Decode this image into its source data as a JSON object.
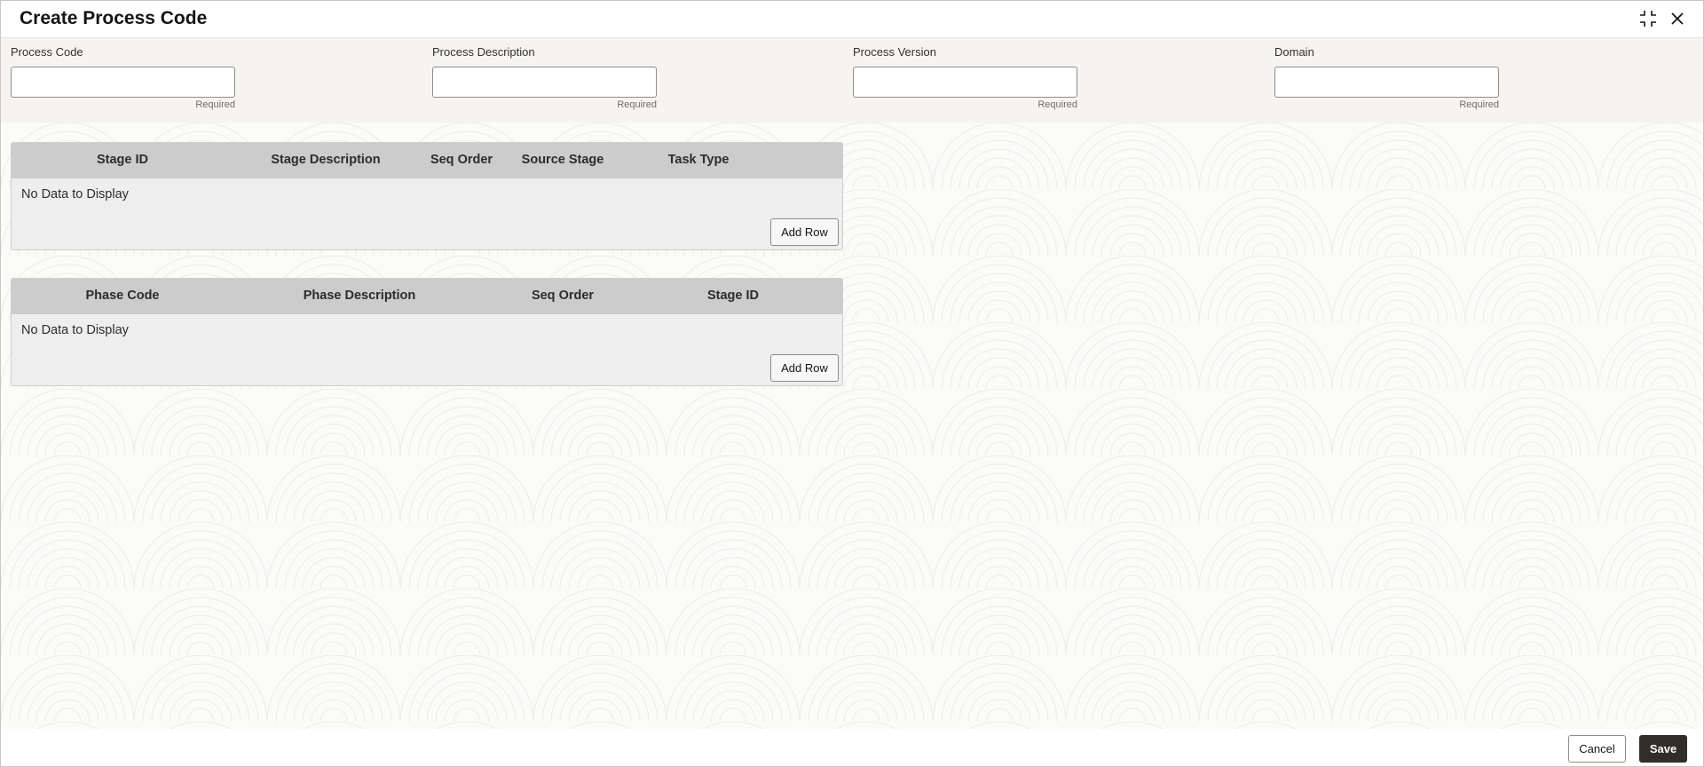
{
  "dialog": {
    "title": "Create Process Code"
  },
  "window_controls": {
    "minimize_icon": "compress-icon",
    "close_icon": "close-icon"
  },
  "fields": [
    {
      "label": "Process Code",
      "value": "",
      "placeholder": "",
      "hint": "Required"
    },
    {
      "label": "Process Description",
      "value": "",
      "placeholder": "",
      "hint": "Required"
    },
    {
      "label": "Process Version",
      "value": "",
      "placeholder": "",
      "hint": "Required"
    },
    {
      "label": "Domain",
      "value": "",
      "placeholder": "",
      "hint": "Required"
    }
  ],
  "stage_grid": {
    "columns": [
      "Stage ID",
      "Stage Description",
      "Seq Order",
      "Source Stage",
      "Task Type"
    ],
    "rows": [],
    "empty_text": "No Data to Display",
    "add_row_label": "Add Row"
  },
  "phase_grid": {
    "columns": [
      "Phase Code",
      "Phase Description",
      "Seq Order",
      "Stage ID"
    ],
    "rows": [],
    "empty_text": "No Data to Display",
    "add_row_label": "Add Row"
  },
  "footer": {
    "cancel_label": "Cancel",
    "save_label": "Save"
  },
  "colors": {
    "save_button_bg": "#312d2a",
    "grid_header_bg": "#cccccc",
    "form_band_bg": "#f5f4f2"
  }
}
